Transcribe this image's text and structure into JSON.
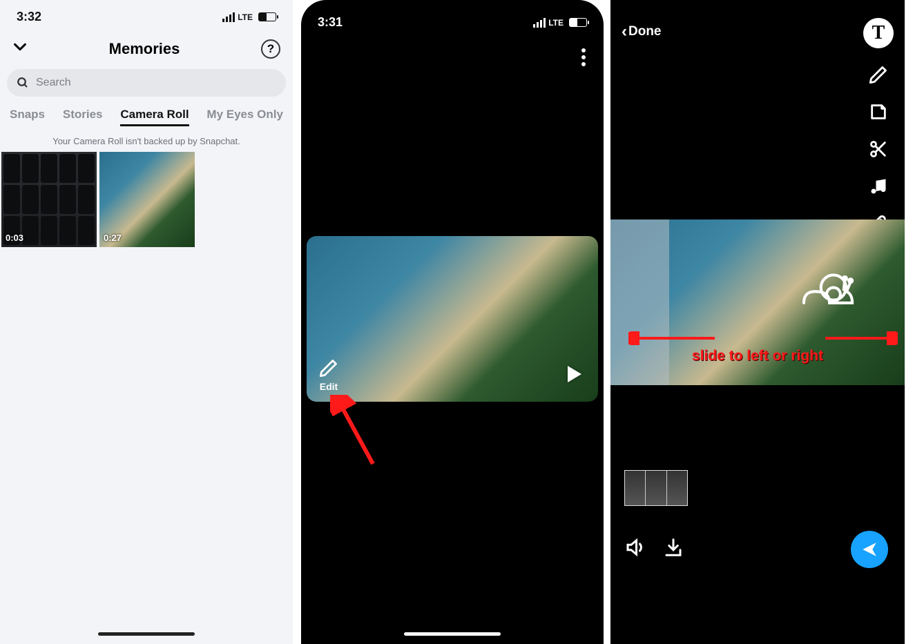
{
  "phone1": {
    "status": {
      "time": "3:32",
      "carrier": "LTE"
    },
    "title": "Memories",
    "search_placeholder": "Search",
    "tabs": {
      "snaps": "Snaps",
      "stories": "Stories",
      "camera_roll": "Camera Roll",
      "my_eyes_only": "My Eyes Only"
    },
    "active_tab": "camera_roll",
    "backup_note": "Your Camera Roll isn't backed up by Snapchat.",
    "thumbs": [
      {
        "duration": "0:03",
        "desc": "keyboard-video"
      },
      {
        "duration": "0:27",
        "desc": "beach-video"
      }
    ]
  },
  "phone2": {
    "status": {
      "time": "3:31",
      "carrier": "LTE"
    },
    "edit_label": "Edit"
  },
  "phone3": {
    "done_label": "Done",
    "tools": {
      "text": "T"
    },
    "annotation_text": "slide to left or right"
  },
  "colors": {
    "annotation_red": "#ff1a1a",
    "send_blue": "#17a3ff"
  }
}
